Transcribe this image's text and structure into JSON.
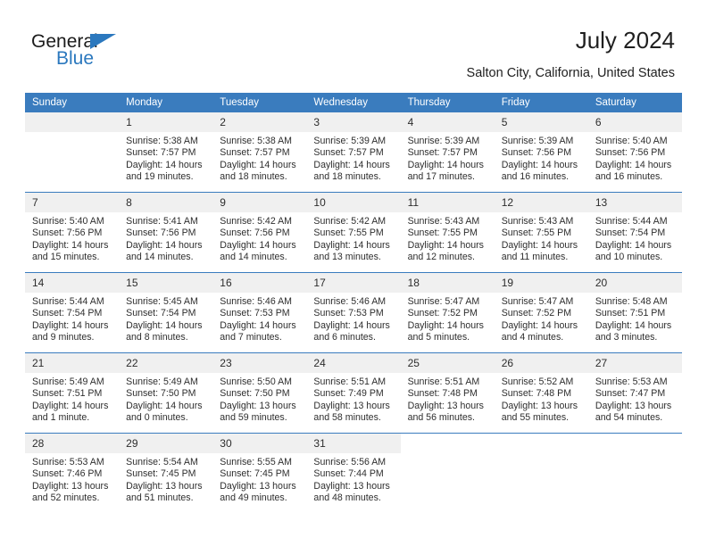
{
  "brand": {
    "name_part1": "General",
    "name_part2": "Blue",
    "triangle_icon": "triangle-icon",
    "accent_color": "#2b78be"
  },
  "header": {
    "title": "July 2024",
    "subtitle": "Salton City, California, United States"
  },
  "theme": {
    "header_blue": "#3a7cbe",
    "daynum_band": "#f0f0f0",
    "text": "#2e2e2e"
  },
  "weekday_headers": [
    "Sunday",
    "Monday",
    "Tuesday",
    "Wednesday",
    "Thursday",
    "Friday",
    "Saturday"
  ],
  "weeks": [
    [
      {
        "day": "",
        "sunrise": "",
        "sunset": "",
        "daylight1": "",
        "daylight2": "",
        "empty": true
      },
      {
        "day": "1",
        "sunrise": "Sunrise: 5:38 AM",
        "sunset": "Sunset: 7:57 PM",
        "daylight1": "Daylight: 14 hours",
        "daylight2": "and 19 minutes."
      },
      {
        "day": "2",
        "sunrise": "Sunrise: 5:38 AM",
        "sunset": "Sunset: 7:57 PM",
        "daylight1": "Daylight: 14 hours",
        "daylight2": "and 18 minutes."
      },
      {
        "day": "3",
        "sunrise": "Sunrise: 5:39 AM",
        "sunset": "Sunset: 7:57 PM",
        "daylight1": "Daylight: 14 hours",
        "daylight2": "and 18 minutes."
      },
      {
        "day": "4",
        "sunrise": "Sunrise: 5:39 AM",
        "sunset": "Sunset: 7:57 PM",
        "daylight1": "Daylight: 14 hours",
        "daylight2": "and 17 minutes."
      },
      {
        "day": "5",
        "sunrise": "Sunrise: 5:39 AM",
        "sunset": "Sunset: 7:56 PM",
        "daylight1": "Daylight: 14 hours",
        "daylight2": "and 16 minutes."
      },
      {
        "day": "6",
        "sunrise": "Sunrise: 5:40 AM",
        "sunset": "Sunset: 7:56 PM",
        "daylight1": "Daylight: 14 hours",
        "daylight2": "and 16 minutes."
      }
    ],
    [
      {
        "day": "7",
        "sunrise": "Sunrise: 5:40 AM",
        "sunset": "Sunset: 7:56 PM",
        "daylight1": "Daylight: 14 hours",
        "daylight2": "and 15 minutes."
      },
      {
        "day": "8",
        "sunrise": "Sunrise: 5:41 AM",
        "sunset": "Sunset: 7:56 PM",
        "daylight1": "Daylight: 14 hours",
        "daylight2": "and 14 minutes."
      },
      {
        "day": "9",
        "sunrise": "Sunrise: 5:42 AM",
        "sunset": "Sunset: 7:56 PM",
        "daylight1": "Daylight: 14 hours",
        "daylight2": "and 14 minutes."
      },
      {
        "day": "10",
        "sunrise": "Sunrise: 5:42 AM",
        "sunset": "Sunset: 7:55 PM",
        "daylight1": "Daylight: 14 hours",
        "daylight2": "and 13 minutes."
      },
      {
        "day": "11",
        "sunrise": "Sunrise: 5:43 AM",
        "sunset": "Sunset: 7:55 PM",
        "daylight1": "Daylight: 14 hours",
        "daylight2": "and 12 minutes."
      },
      {
        "day": "12",
        "sunrise": "Sunrise: 5:43 AM",
        "sunset": "Sunset: 7:55 PM",
        "daylight1": "Daylight: 14 hours",
        "daylight2": "and 11 minutes."
      },
      {
        "day": "13",
        "sunrise": "Sunrise: 5:44 AM",
        "sunset": "Sunset: 7:54 PM",
        "daylight1": "Daylight: 14 hours",
        "daylight2": "and 10 minutes."
      }
    ],
    [
      {
        "day": "14",
        "sunrise": "Sunrise: 5:44 AM",
        "sunset": "Sunset: 7:54 PM",
        "daylight1": "Daylight: 14 hours",
        "daylight2": "and 9 minutes."
      },
      {
        "day": "15",
        "sunrise": "Sunrise: 5:45 AM",
        "sunset": "Sunset: 7:54 PM",
        "daylight1": "Daylight: 14 hours",
        "daylight2": "and 8 minutes."
      },
      {
        "day": "16",
        "sunrise": "Sunrise: 5:46 AM",
        "sunset": "Sunset: 7:53 PM",
        "daylight1": "Daylight: 14 hours",
        "daylight2": "and 7 minutes."
      },
      {
        "day": "17",
        "sunrise": "Sunrise: 5:46 AM",
        "sunset": "Sunset: 7:53 PM",
        "daylight1": "Daylight: 14 hours",
        "daylight2": "and 6 minutes."
      },
      {
        "day": "18",
        "sunrise": "Sunrise: 5:47 AM",
        "sunset": "Sunset: 7:52 PM",
        "daylight1": "Daylight: 14 hours",
        "daylight2": "and 5 minutes."
      },
      {
        "day": "19",
        "sunrise": "Sunrise: 5:47 AM",
        "sunset": "Sunset: 7:52 PM",
        "daylight1": "Daylight: 14 hours",
        "daylight2": "and 4 minutes."
      },
      {
        "day": "20",
        "sunrise": "Sunrise: 5:48 AM",
        "sunset": "Sunset: 7:51 PM",
        "daylight1": "Daylight: 14 hours",
        "daylight2": "and 3 minutes."
      }
    ],
    [
      {
        "day": "21",
        "sunrise": "Sunrise: 5:49 AM",
        "sunset": "Sunset: 7:51 PM",
        "daylight1": "Daylight: 14 hours",
        "daylight2": "and 1 minute."
      },
      {
        "day": "22",
        "sunrise": "Sunrise: 5:49 AM",
        "sunset": "Sunset: 7:50 PM",
        "daylight1": "Daylight: 14 hours",
        "daylight2": "and 0 minutes."
      },
      {
        "day": "23",
        "sunrise": "Sunrise: 5:50 AM",
        "sunset": "Sunset: 7:50 PM",
        "daylight1": "Daylight: 13 hours",
        "daylight2": "and 59 minutes."
      },
      {
        "day": "24",
        "sunrise": "Sunrise: 5:51 AM",
        "sunset": "Sunset: 7:49 PM",
        "daylight1": "Daylight: 13 hours",
        "daylight2": "and 58 minutes."
      },
      {
        "day": "25",
        "sunrise": "Sunrise: 5:51 AM",
        "sunset": "Sunset: 7:48 PM",
        "daylight1": "Daylight: 13 hours",
        "daylight2": "and 56 minutes."
      },
      {
        "day": "26",
        "sunrise": "Sunrise: 5:52 AM",
        "sunset": "Sunset: 7:48 PM",
        "daylight1": "Daylight: 13 hours",
        "daylight2": "and 55 minutes."
      },
      {
        "day": "27",
        "sunrise": "Sunrise: 5:53 AM",
        "sunset": "Sunset: 7:47 PM",
        "daylight1": "Daylight: 13 hours",
        "daylight2": "and 54 minutes."
      }
    ],
    [
      {
        "day": "28",
        "sunrise": "Sunrise: 5:53 AM",
        "sunset": "Sunset: 7:46 PM",
        "daylight1": "Daylight: 13 hours",
        "daylight2": "and 52 minutes."
      },
      {
        "day": "29",
        "sunrise": "Sunrise: 5:54 AM",
        "sunset": "Sunset: 7:45 PM",
        "daylight1": "Daylight: 13 hours",
        "daylight2": "and 51 minutes."
      },
      {
        "day": "30",
        "sunrise": "Sunrise: 5:55 AM",
        "sunset": "Sunset: 7:45 PM",
        "daylight1": "Daylight: 13 hours",
        "daylight2": "and 49 minutes."
      },
      {
        "day": "31",
        "sunrise": "Sunrise: 5:56 AM",
        "sunset": "Sunset: 7:44 PM",
        "daylight1": "Daylight: 13 hours",
        "daylight2": "and 48 minutes."
      },
      {
        "day": "",
        "sunrise": "",
        "sunset": "",
        "daylight1": "",
        "daylight2": "",
        "blank": true
      },
      {
        "day": "",
        "sunrise": "",
        "sunset": "",
        "daylight1": "",
        "daylight2": "",
        "blank": true
      },
      {
        "day": "",
        "sunrise": "",
        "sunset": "",
        "daylight1": "",
        "daylight2": "",
        "blank": true
      }
    ]
  ]
}
